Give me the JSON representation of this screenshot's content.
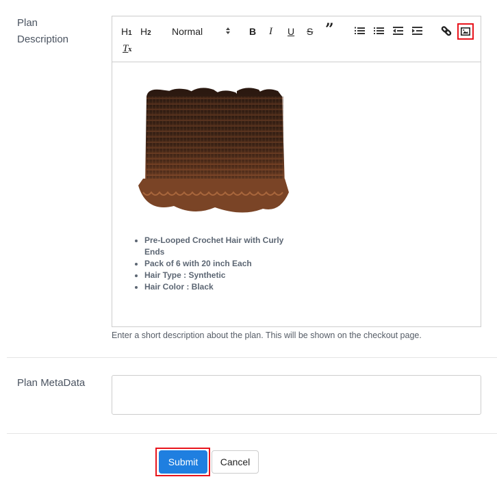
{
  "form": {
    "description": {
      "label_line1": "Plan",
      "label_line2": "Description",
      "help_text": "Enter a short description about the plan. This will be shown on the checkout page."
    },
    "metadata": {
      "label": "Plan MetaData",
      "value": ""
    }
  },
  "toolbar": {
    "h1": "H",
    "h1_sub": "1",
    "h2": "H",
    "h2_sub": "2",
    "format_select": "Normal",
    "format_select_arrow": "↕",
    "bold": "B",
    "italic": "I",
    "underline": "U",
    "strike": "S",
    "blockquote": "”",
    "clear_format": "T",
    "clear_format_sub": "x",
    "icons": [
      "heading-1-icon",
      "heading-2-icon",
      "bold-icon",
      "italic-icon",
      "underline-icon",
      "strikethrough-icon",
      "blockquote-icon",
      "ordered-list-icon",
      "bullet-list-icon",
      "outdent-icon",
      "indent-icon",
      "link-icon",
      "image-icon",
      "clear-format-icon"
    ],
    "highlight_color": "#e8131b"
  },
  "editor_content": {
    "image_alt": "Brown crochet hair bundles with curly ends",
    "bullets": [
      "Pre-Looped Crochet Hair with Curly Ends",
      "Pack of 6 with 20 inch Each",
      "Hair Type : Synthetic",
      "Hair Color : Black"
    ]
  },
  "actions": {
    "submit_label": "Submit",
    "cancel_label": "Cancel",
    "submit_color": "#1f7fe0"
  }
}
